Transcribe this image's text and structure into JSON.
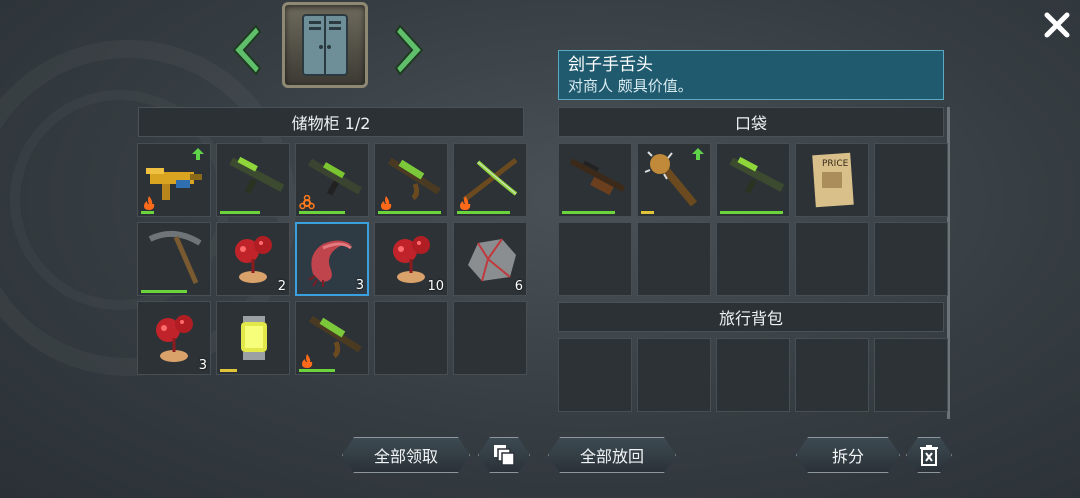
{
  "title_selector": {
    "container_icon": "metal-locker-icon"
  },
  "tooltip": {
    "name": "刽子手舌头",
    "description": "对商人 颇具价值。"
  },
  "storage": {
    "header": "储物柜 1/2",
    "slots": [
      {
        "icon": "golden-smg-icon",
        "durability": 0.2,
        "badge": "fire",
        "upgrade": true
      },
      {
        "icon": "green-rifle-icon",
        "durability": 0.6
      },
      {
        "icon": "green-assault-rifle-icon",
        "durability": 0.7,
        "badge": "biohazard"
      },
      {
        "icon": "green-ak-icon",
        "durability": 0.95,
        "badge": "fire"
      },
      {
        "icon": "green-crossbow-icon",
        "durability": 0.8,
        "badge": "fire"
      },
      {
        "icon": "pickaxe-icon",
        "durability": 0.7
      },
      {
        "icon": "red-virus-sample-icon",
        "count": "2"
      },
      {
        "icon": "executioner-tongue-icon",
        "count": "3",
        "selected": true
      },
      {
        "icon": "red-virus-sample-icon",
        "count": "10"
      },
      {
        "icon": "rock-ore-icon",
        "count": "6"
      },
      {
        "icon": "red-virus-sample-icon",
        "count": "3"
      },
      {
        "icon": "glowing-lantern-icon",
        "durability": 0.25,
        "durability_color": "yellow"
      },
      {
        "icon": "green-ak-icon",
        "durability": 0.55,
        "badge": "fire"
      },
      {
        "icon": ""
      },
      {
        "icon": ""
      }
    ]
  },
  "pocket": {
    "header": "口袋",
    "slots": [
      {
        "icon": "hunting-rifle-icon",
        "durability": 0.8
      },
      {
        "icon": "spiked-club-icon",
        "durability": 0.2,
        "durability_color": "yellow",
        "upgrade": true
      },
      {
        "icon": "green-rifle-icon",
        "durability": 0.95
      },
      {
        "icon": "price-poster-icon"
      },
      {
        "icon": ""
      },
      {
        "icon": ""
      },
      {
        "icon": ""
      },
      {
        "icon": ""
      },
      {
        "icon": ""
      },
      {
        "icon": ""
      }
    ]
  },
  "travel_backpack": {
    "header": "旅行背包",
    "slots": [
      {
        "icon": ""
      },
      {
        "icon": ""
      },
      {
        "icon": ""
      },
      {
        "icon": ""
      },
      {
        "icon": ""
      }
    ]
  },
  "buttons": {
    "collect_all": "全部领取",
    "stack": "stack-icon",
    "return_all": "全部放回",
    "split": "拆分",
    "trash": "trash-icon"
  },
  "colors": {
    "durability_green": "#6bd33b",
    "durability_yellow": "#e0c53a",
    "selected_border": "#3aa0e0",
    "tooltip_bg": "#1f5a6e"
  }
}
